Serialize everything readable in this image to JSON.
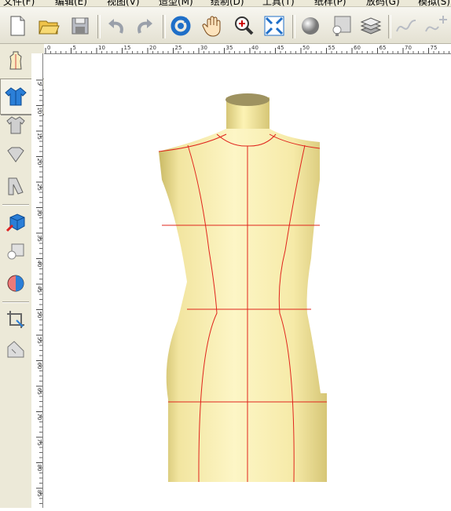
{
  "menu": [
    {
      "label": "文件(F)"
    },
    {
      "label": "编辑(E)"
    },
    {
      "label": "视图(V)"
    },
    {
      "label": "造型(M)"
    },
    {
      "label": "绘制(D)"
    },
    {
      "label": "工具(T)"
    },
    {
      "label": "纸样(P)"
    },
    {
      "label": "放码(G)"
    },
    {
      "label": "模拟(S)"
    }
  ],
  "toolbar": {
    "icons": [
      "new-file-icon",
      "open-folder-icon",
      "save-icon",
      "undo-icon",
      "redo-icon",
      "rotate-view-icon",
      "pan-hand-icon",
      "zoom-icon",
      "fit-view-icon",
      "sphere-shading-icon",
      "light-icon",
      "layers-icon",
      "curve-icon",
      "add-curve-icon"
    ]
  },
  "left_tools": {
    "icons": [
      "mannequin-icon",
      "garment-front-icon",
      "collar-icon",
      "sleeve-icon",
      "color-cube-icon",
      "lighting-icon",
      "half-tone-sphere-icon",
      "crop-tool-icon",
      "measure-tool-icon"
    ]
  },
  "popup": {
    "icons": [
      "shirt-blue-icon",
      "shirt-gray-icon",
      "torso-blue-selected-icon",
      "shirt-small-icon"
    ],
    "selected_index": 2
  },
  "ruler": {
    "top_ticks": [
      "0",
      "5",
      "10",
      "15",
      "20",
      "25",
      "30",
      "35",
      "40",
      "45",
      "50",
      "55",
      "60",
      "65",
      "70",
      "75"
    ],
    "left_ticks": [
      "5",
      "10",
      "15",
      "20",
      "25",
      "30",
      "35",
      "40",
      "45",
      "50",
      "55",
      "60",
      "65",
      "70",
      "75",
      "80",
      "85"
    ]
  },
  "colors": {
    "mannequin_fill": "#fdf3b4",
    "mannequin_shade": "#c9b964",
    "guide_lines": "#e0241c",
    "highlight_circle": "#e8271c",
    "accent_blue": "#2b7fd8"
  }
}
